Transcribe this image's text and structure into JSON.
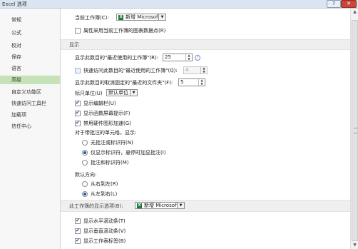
{
  "window": {
    "title": "Excel 选项",
    "help_label": "?",
    "close_label": "✕"
  },
  "sidebar": {
    "items": [
      {
        "label": "常规"
      },
      {
        "label": "公式"
      },
      {
        "label": "校对"
      },
      {
        "label": "保存"
      },
      {
        "label": "语言"
      },
      {
        "label": "高级"
      },
      {
        "label": "自定义功能区"
      },
      {
        "label": "快速访问工具栏"
      },
      {
        "label": "加载项"
      },
      {
        "label": "信任中心"
      }
    ],
    "active": "高级"
  },
  "content": {
    "current_workbook_label": "当前工作簿(C):",
    "current_workbook_value": "新增 Microsoft...",
    "chart_property_label": "属性采用当前工作簿的图表数据点(R)",
    "display_header": "显示",
    "recent_workbooks_label": "显示此数目的\"最近使用的工作簿\"(R):",
    "recent_workbooks_value": "25",
    "quick_access_label": "快速访问此数目的\"最近使用的工作簿\"(Q):",
    "quick_access_value": "4",
    "recent_folders_label": "显示此数目的取消固定的\"最近的文件夹\"(F):",
    "recent_folders_value": "5",
    "ruler_units_label": "标尺单位(U)",
    "ruler_units_value": "默认单位",
    "show_formula_bar": "显示编辑栏(U)",
    "show_function_tips": "显示函数屏幕提示(F)",
    "disable_hw_accel": "禁用硬件图形加速(G)",
    "comments_label": "对于带批注的单元格，显示:",
    "no_comments": "无批注或标识符(N)",
    "indicators_only": "仅显示标识符，悬停时加显批注(I)",
    "comments_and_indicators": "批注和标识符(M)",
    "default_direction_label": "默认方向:",
    "right_to_left": "从右到左(R)",
    "left_to_right": "从左到右(L)",
    "workbook_display_header": "此工作簿的显示选项(B):",
    "workbook_display_value": "新增 Microsoft...",
    "show_h_scrollbar": "显示水平滚动条(T)",
    "show_v_scrollbar": "显示垂直滚动条(V)",
    "show_sheet_tabs": "显示工作表标签(B)"
  },
  "icons": {
    "excel_icon": "excel-icon",
    "info_icon": "info-icon"
  }
}
